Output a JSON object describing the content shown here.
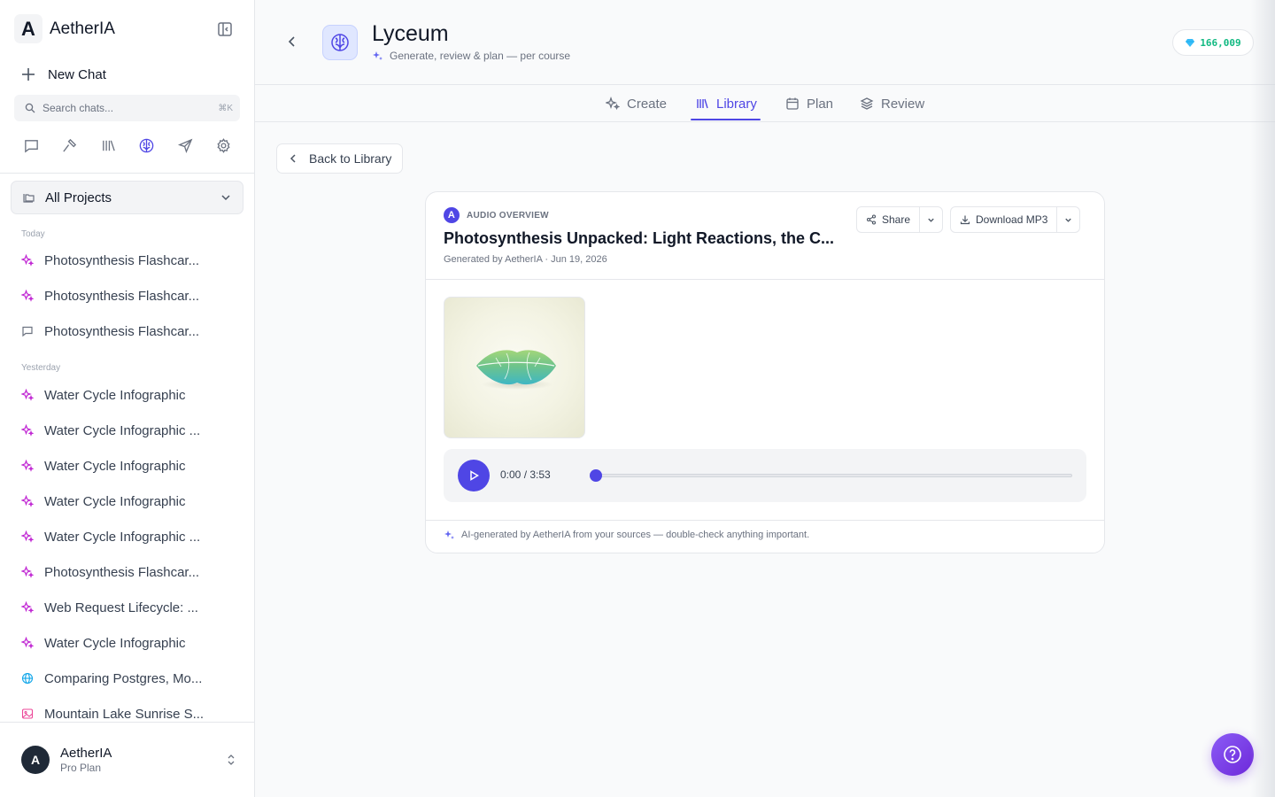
{
  "sidebar": {
    "brand": {
      "logo_letter": "A",
      "name": "AetherIA"
    },
    "new_chat_label": "New Chat",
    "search": {
      "placeholder": "Search chats...",
      "shortcut": "⌘K"
    },
    "nav_icons": [
      "chat-icon",
      "hammer-icon",
      "library-icon",
      "brain-icon",
      "send-icon",
      "settings-icon"
    ],
    "projects_label": "All Projects",
    "groups": [
      {
        "label": "Today",
        "items": [
          {
            "title": "Photosynthesis Flashcar...",
            "icon": "sparkles-icon"
          },
          {
            "title": "Photosynthesis Flashcar...",
            "icon": "sparkles-icon"
          },
          {
            "title": "Photosynthesis Flashcar...",
            "icon": "chat-icon"
          }
        ]
      },
      {
        "label": "Yesterday",
        "items": [
          {
            "title": "Water Cycle Infographic",
            "icon": "sparkles-icon"
          },
          {
            "title": "Water Cycle Infographic ...",
            "icon": "sparkles-icon"
          },
          {
            "title": "Water Cycle Infographic",
            "icon": "sparkles-icon"
          },
          {
            "title": "Water Cycle Infographic",
            "icon": "sparkles-icon"
          },
          {
            "title": "Water Cycle Infographic ...",
            "icon": "sparkles-icon"
          },
          {
            "title": "Photosynthesis Flashcar...",
            "icon": "sparkles-icon"
          },
          {
            "title": "Web Request Lifecycle: ...",
            "icon": "sparkles-icon"
          },
          {
            "title": "Water Cycle Infographic",
            "icon": "sparkles-icon"
          },
          {
            "title": "Comparing Postgres, Mo...",
            "icon": "globe-icon"
          },
          {
            "title": "Mountain Lake Sunrise S...",
            "icon": "image-icon"
          }
        ]
      }
    ],
    "user": {
      "initial": "A",
      "name": "AetherIA",
      "plan": "Pro Plan"
    }
  },
  "header": {
    "title": "Lyceum",
    "subtitle": "Generate, review & plan — per course",
    "credits": "166,009"
  },
  "tabs": [
    {
      "label": "Create",
      "icon": "sparkles-icon"
    },
    {
      "label": "Library",
      "icon": "library-icon",
      "active": true
    },
    {
      "label": "Plan",
      "icon": "calendar-icon"
    },
    {
      "label": "Review",
      "icon": "layers-icon"
    }
  ],
  "back_to_library_label": "Back to Library",
  "card": {
    "badge_letter": "A",
    "kicker": "AUDIO OVERVIEW",
    "title": "Photosynthesis Unpacked: Light Reactions, the C...",
    "meta": "Generated by AetherIA · Jun 19, 2026",
    "share_label": "Share",
    "download_label": "Download MP3",
    "player": {
      "time": "0:00 / 3:53",
      "progress": 0
    },
    "footer_note": "AI-generated by AetherIA from your sources — double-check anything important."
  },
  "colors": {
    "accent": "#4f46e5",
    "credits_text": "#10b981",
    "sparkle_magenta": "#c026d3",
    "globe": "#0ea5e9",
    "image_icon": "#ec4899"
  }
}
